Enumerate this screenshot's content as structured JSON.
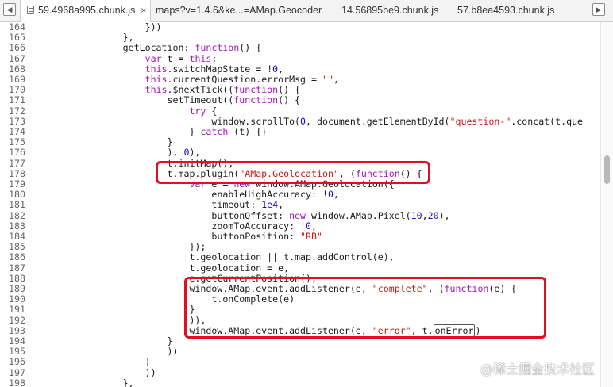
{
  "tabs": [
    {
      "label": "59.4968a995.chunk.js",
      "active": true
    },
    {
      "label": "maps?v=1.4.6&ke...=AMap.Geocoder",
      "active": false
    },
    {
      "label": "14.56895be9.chunk.js",
      "active": false
    },
    {
      "label": "57.b8ea4593.chunk.js",
      "active": false
    }
  ],
  "tabbar": {
    "nav_left_icon": "panel-left-icon",
    "close_glyph": "×",
    "nav_right_icon": "expand-right-icon"
  },
  "code": {
    "lines": [
      {
        "n": "164",
        "tokens": [
          [
            "p",
            "                    }))"
          ]
        ]
      },
      {
        "n": "165",
        "tokens": [
          [
            "p",
            "                },"
          ]
        ]
      },
      {
        "n": "166",
        "tokens": [
          [
            "p",
            "                getLocation: "
          ],
          [
            "k",
            "function"
          ],
          [
            "p",
            "() {"
          ]
        ]
      },
      {
        "n": "167",
        "tokens": [
          [
            "p",
            "                    "
          ],
          [
            "k",
            "var"
          ],
          [
            "p",
            " t = "
          ],
          [
            "k",
            "this"
          ],
          [
            "p",
            ";"
          ]
        ]
      },
      {
        "n": "168",
        "tokens": [
          [
            "p",
            "                    "
          ],
          [
            "k",
            "this"
          ],
          [
            "p",
            ".switchMapState = !"
          ],
          [
            "num",
            "0"
          ],
          [
            "p",
            ","
          ]
        ]
      },
      {
        "n": "169",
        "tokens": [
          [
            "p",
            "                    "
          ],
          [
            "k",
            "this"
          ],
          [
            "p",
            ".currentQuestion.errorMsg = "
          ],
          [
            "s",
            "\"\""
          ],
          [
            "p",
            ","
          ]
        ]
      },
      {
        "n": "170",
        "tokens": [
          [
            "p",
            "                    "
          ],
          [
            "k",
            "this"
          ],
          [
            "p",
            ".$nextTick(("
          ],
          [
            "k",
            "function"
          ],
          [
            "p",
            "() {"
          ]
        ]
      },
      {
        "n": "171",
        "tokens": [
          [
            "p",
            "                        setTimeout(("
          ],
          [
            "k",
            "function"
          ],
          [
            "p",
            "() {"
          ]
        ]
      },
      {
        "n": "172",
        "tokens": [
          [
            "p",
            "                            "
          ],
          [
            "k",
            "try"
          ],
          [
            "p",
            " {"
          ]
        ]
      },
      {
        "n": "173",
        "tokens": [
          [
            "p",
            "                                window.scrollTo("
          ],
          [
            "num",
            "0"
          ],
          [
            "p",
            ", document.getElementById("
          ],
          [
            "s",
            "\"question-\""
          ],
          [
            "p",
            ".concat(t.que"
          ]
        ]
      },
      {
        "n": "174",
        "tokens": [
          [
            "p",
            "                            } "
          ],
          [
            "k",
            "catch"
          ],
          [
            "p",
            " (t) {}"
          ]
        ]
      },
      {
        "n": "175",
        "tokens": [
          [
            "p",
            "                        }"
          ]
        ]
      },
      {
        "n": "176",
        "tokens": [
          [
            "p",
            "                        ), "
          ],
          [
            "num",
            "0"
          ],
          [
            "p",
            "),"
          ]
        ]
      },
      {
        "n": "177",
        "tokens": [
          [
            "p",
            "                        t.initMap(),"
          ]
        ]
      },
      {
        "n": "178",
        "tokens": [
          [
            "p",
            "                        t.map.plugin("
          ],
          [
            "s",
            "\"AMap.Geolocation\""
          ],
          [
            "p",
            ", ("
          ],
          [
            "k",
            "function"
          ],
          [
            "p",
            "() {"
          ]
        ]
      },
      {
        "n": "179",
        "tokens": [
          [
            "p",
            "                            "
          ],
          [
            "k",
            "var"
          ],
          [
            "p",
            " e = "
          ],
          [
            "k",
            "new"
          ],
          [
            "p",
            " window.AMap.Geolocation({"
          ]
        ]
      },
      {
        "n": "180",
        "tokens": [
          [
            "p",
            "                                enableHighAccuracy: !"
          ],
          [
            "num",
            "0"
          ],
          [
            "p",
            ","
          ]
        ]
      },
      {
        "n": "181",
        "tokens": [
          [
            "p",
            "                                timeout: "
          ],
          [
            "num",
            "1e4"
          ],
          [
            "p",
            ","
          ]
        ]
      },
      {
        "n": "182",
        "tokens": [
          [
            "p",
            "                                buttonOffset: "
          ],
          [
            "k",
            "new"
          ],
          [
            "p",
            " window.AMap.Pixel("
          ],
          [
            "num",
            "10"
          ],
          [
            "p",
            ","
          ],
          [
            "num",
            "20"
          ],
          [
            "p",
            "),"
          ]
        ]
      },
      {
        "n": "183",
        "tokens": [
          [
            "p",
            "                                zoomToAccuracy: !"
          ],
          [
            "num",
            "0"
          ],
          [
            "p",
            ","
          ]
        ]
      },
      {
        "n": "184",
        "tokens": [
          [
            "p",
            "                                buttonPosition: "
          ],
          [
            "s",
            "\"RB\""
          ]
        ]
      },
      {
        "n": "185",
        "tokens": [
          [
            "p",
            "                            });"
          ]
        ]
      },
      {
        "n": "186",
        "tokens": [
          [
            "p",
            "                            t.geolocation || t.map.addControl(e),"
          ]
        ]
      },
      {
        "n": "187",
        "tokens": [
          [
            "p",
            "                            t.geolocation = e,"
          ]
        ]
      },
      {
        "n": "188",
        "tokens": [
          [
            "p",
            "                            e.getCurrentPosition(),"
          ]
        ]
      },
      {
        "n": "189",
        "tokens": [
          [
            "p",
            "                            window.AMap.event.addListener(e, "
          ],
          [
            "s",
            "\"complete\""
          ],
          [
            "p",
            ", ("
          ],
          [
            "k",
            "function"
          ],
          [
            "p",
            "(e) {"
          ]
        ]
      },
      {
        "n": "190",
        "tokens": [
          [
            "p",
            "                                t.onComplete(e)"
          ]
        ]
      },
      {
        "n": "191",
        "tokens": [
          [
            "p",
            "                            }"
          ]
        ]
      },
      {
        "n": "192",
        "tokens": [
          [
            "p",
            "                            )),"
          ]
        ]
      },
      {
        "n": "193",
        "tokens": [
          [
            "p",
            "                            window.AMap.event.addListener(e, "
          ],
          [
            "s",
            "\"error\""
          ],
          [
            "p",
            ", t."
          ],
          [
            "box",
            "onError"
          ],
          [
            "p",
            ")"
          ]
        ]
      },
      {
        "n": "194",
        "tokens": [
          [
            "p",
            "                        }"
          ]
        ]
      },
      {
        "n": "195",
        "tokens": [
          [
            "p",
            "                        ))"
          ]
        ]
      },
      {
        "n": "196",
        "tokens": [
          [
            "p",
            "                    "
          ],
          [
            "cur",
            "}"
          ]
        ]
      },
      {
        "n": "197",
        "tokens": [
          [
            "p",
            "                    ))"
          ]
        ]
      },
      {
        "n": "198",
        "tokens": [
          [
            "p",
            "                },"
          ]
        ]
      }
    ]
  },
  "highlight_color": "#e0101f",
  "watermark": "@稀土掘金技术社区"
}
